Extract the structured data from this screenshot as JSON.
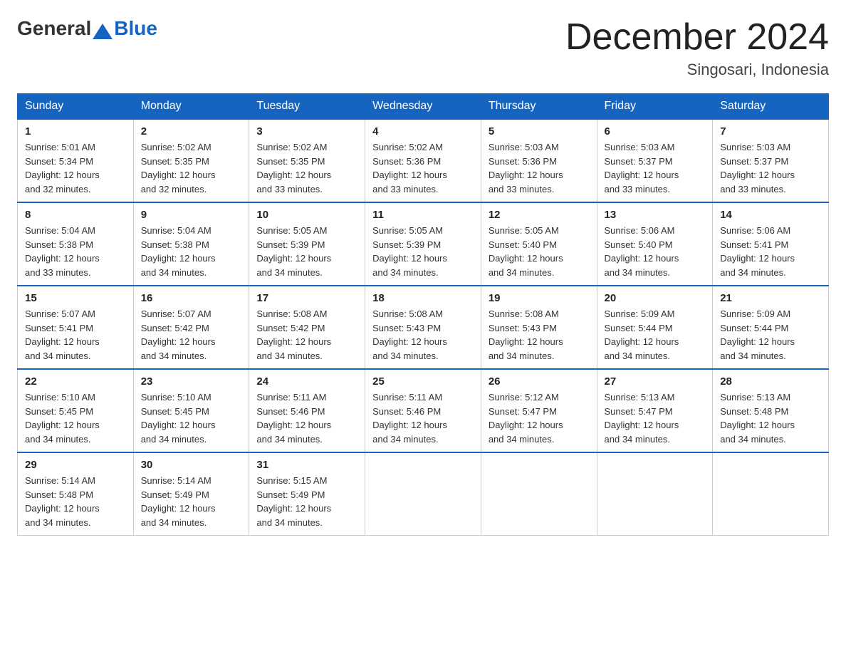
{
  "header": {
    "logo_general": "General",
    "logo_blue": "Blue",
    "title": "December 2024",
    "subtitle": "Singosari, Indonesia"
  },
  "days_of_week": [
    "Sunday",
    "Monday",
    "Tuesday",
    "Wednesday",
    "Thursday",
    "Friday",
    "Saturday"
  ],
  "weeks": [
    [
      {
        "day": "1",
        "sunrise": "5:01 AM",
        "sunset": "5:34 PM",
        "daylight": "12 hours and 32 minutes."
      },
      {
        "day": "2",
        "sunrise": "5:02 AM",
        "sunset": "5:35 PM",
        "daylight": "12 hours and 32 minutes."
      },
      {
        "day": "3",
        "sunrise": "5:02 AM",
        "sunset": "5:35 PM",
        "daylight": "12 hours and 33 minutes."
      },
      {
        "day": "4",
        "sunrise": "5:02 AM",
        "sunset": "5:36 PM",
        "daylight": "12 hours and 33 minutes."
      },
      {
        "day": "5",
        "sunrise": "5:03 AM",
        "sunset": "5:36 PM",
        "daylight": "12 hours and 33 minutes."
      },
      {
        "day": "6",
        "sunrise": "5:03 AM",
        "sunset": "5:37 PM",
        "daylight": "12 hours and 33 minutes."
      },
      {
        "day": "7",
        "sunrise": "5:03 AM",
        "sunset": "5:37 PM",
        "daylight": "12 hours and 33 minutes."
      }
    ],
    [
      {
        "day": "8",
        "sunrise": "5:04 AM",
        "sunset": "5:38 PM",
        "daylight": "12 hours and 33 minutes."
      },
      {
        "day": "9",
        "sunrise": "5:04 AM",
        "sunset": "5:38 PM",
        "daylight": "12 hours and 34 minutes."
      },
      {
        "day": "10",
        "sunrise": "5:05 AM",
        "sunset": "5:39 PM",
        "daylight": "12 hours and 34 minutes."
      },
      {
        "day": "11",
        "sunrise": "5:05 AM",
        "sunset": "5:39 PM",
        "daylight": "12 hours and 34 minutes."
      },
      {
        "day": "12",
        "sunrise": "5:05 AM",
        "sunset": "5:40 PM",
        "daylight": "12 hours and 34 minutes."
      },
      {
        "day": "13",
        "sunrise": "5:06 AM",
        "sunset": "5:40 PM",
        "daylight": "12 hours and 34 minutes."
      },
      {
        "day": "14",
        "sunrise": "5:06 AM",
        "sunset": "5:41 PM",
        "daylight": "12 hours and 34 minutes."
      }
    ],
    [
      {
        "day": "15",
        "sunrise": "5:07 AM",
        "sunset": "5:41 PM",
        "daylight": "12 hours and 34 minutes."
      },
      {
        "day": "16",
        "sunrise": "5:07 AM",
        "sunset": "5:42 PM",
        "daylight": "12 hours and 34 minutes."
      },
      {
        "day": "17",
        "sunrise": "5:08 AM",
        "sunset": "5:42 PM",
        "daylight": "12 hours and 34 minutes."
      },
      {
        "day": "18",
        "sunrise": "5:08 AM",
        "sunset": "5:43 PM",
        "daylight": "12 hours and 34 minutes."
      },
      {
        "day": "19",
        "sunrise": "5:08 AM",
        "sunset": "5:43 PM",
        "daylight": "12 hours and 34 minutes."
      },
      {
        "day": "20",
        "sunrise": "5:09 AM",
        "sunset": "5:44 PM",
        "daylight": "12 hours and 34 minutes."
      },
      {
        "day": "21",
        "sunrise": "5:09 AM",
        "sunset": "5:44 PM",
        "daylight": "12 hours and 34 minutes."
      }
    ],
    [
      {
        "day": "22",
        "sunrise": "5:10 AM",
        "sunset": "5:45 PM",
        "daylight": "12 hours and 34 minutes."
      },
      {
        "day": "23",
        "sunrise": "5:10 AM",
        "sunset": "5:45 PM",
        "daylight": "12 hours and 34 minutes."
      },
      {
        "day": "24",
        "sunrise": "5:11 AM",
        "sunset": "5:46 PM",
        "daylight": "12 hours and 34 minutes."
      },
      {
        "day": "25",
        "sunrise": "5:11 AM",
        "sunset": "5:46 PM",
        "daylight": "12 hours and 34 minutes."
      },
      {
        "day": "26",
        "sunrise": "5:12 AM",
        "sunset": "5:47 PM",
        "daylight": "12 hours and 34 minutes."
      },
      {
        "day": "27",
        "sunrise": "5:13 AM",
        "sunset": "5:47 PM",
        "daylight": "12 hours and 34 minutes."
      },
      {
        "day": "28",
        "sunrise": "5:13 AM",
        "sunset": "5:48 PM",
        "daylight": "12 hours and 34 minutes."
      }
    ],
    [
      {
        "day": "29",
        "sunrise": "5:14 AM",
        "sunset": "5:48 PM",
        "daylight": "12 hours and 34 minutes."
      },
      {
        "day": "30",
        "sunrise": "5:14 AM",
        "sunset": "5:49 PM",
        "daylight": "12 hours and 34 minutes."
      },
      {
        "day": "31",
        "sunrise": "5:15 AM",
        "sunset": "5:49 PM",
        "daylight": "12 hours and 34 minutes."
      },
      null,
      null,
      null,
      null
    ]
  ],
  "labels": {
    "sunrise": "Sunrise:",
    "sunset": "Sunset:",
    "daylight": "Daylight:"
  }
}
